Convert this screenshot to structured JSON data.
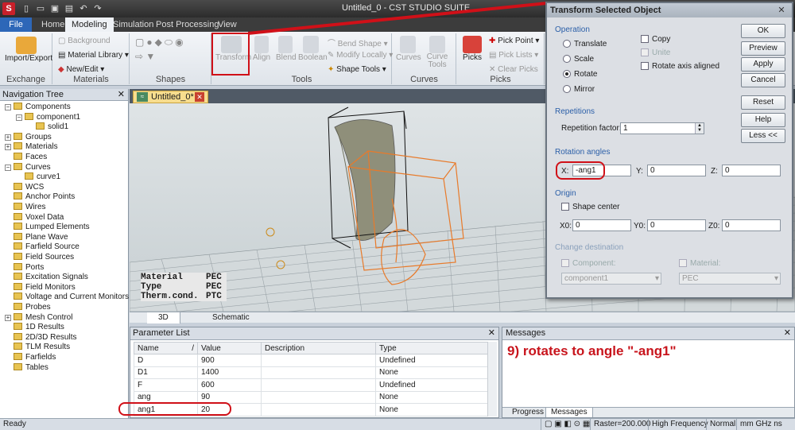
{
  "window": {
    "title": "Untitled_0 - CST STUDIO SUITE"
  },
  "menu_tabs": [
    "File",
    "Home",
    "Modeling",
    "Simulation",
    "Post Processing",
    "View"
  ],
  "ribbon": {
    "exchange": {
      "import_export": "Import/Export",
      "label": "Exchange"
    },
    "materials": {
      "background": "Background",
      "library": "Material Library",
      "new_edit": "New/Edit",
      "label": "Materials"
    },
    "shapes": {
      "label": "Shapes"
    },
    "tools": {
      "transform": "Transform",
      "align": "Align",
      "blend": "Blend",
      "boolean": "Boolean",
      "bend_shape": "Bend Shape",
      "modify_locally": "Modify Locally",
      "shape_tools": "Shape Tools",
      "label": "Tools"
    },
    "curves": {
      "curves": "Curves",
      "curve_tools": "Curve\nTools",
      "label": "Curves"
    },
    "picks": {
      "picks": "Picks",
      "pick_point": "Pick Point",
      "pick_lists": "Pick Lists",
      "clear_picks": "Clear Picks",
      "label": "Picks"
    }
  },
  "nav_tree": {
    "title": "Navigation Tree",
    "items": [
      {
        "label": "Components",
        "level": 0,
        "exp": "⊟"
      },
      {
        "label": "component1",
        "level": 1,
        "exp": "⊟"
      },
      {
        "label": "solid1",
        "level": 2,
        "exp": ""
      },
      {
        "label": "Groups",
        "level": 0,
        "exp": "⊞"
      },
      {
        "label": "Materials",
        "level": 0,
        "exp": "⊞"
      },
      {
        "label": "Faces",
        "level": 0,
        "exp": ""
      },
      {
        "label": "Curves",
        "level": 0,
        "exp": "⊟"
      },
      {
        "label": "curve1",
        "level": 1,
        "exp": ""
      },
      {
        "label": "WCS",
        "level": 0,
        "exp": ""
      },
      {
        "label": "Anchor Points",
        "level": 0,
        "exp": ""
      },
      {
        "label": "Wires",
        "level": 0,
        "exp": ""
      },
      {
        "label": "Voxel Data",
        "level": 0,
        "exp": ""
      },
      {
        "label": "Lumped Elements",
        "level": 0,
        "exp": ""
      },
      {
        "label": "Plane Wave",
        "level": 0,
        "exp": ""
      },
      {
        "label": "Farfield Source",
        "level": 0,
        "exp": ""
      },
      {
        "label": "Field Sources",
        "level": 0,
        "exp": ""
      },
      {
        "label": "Ports",
        "level": 0,
        "exp": ""
      },
      {
        "label": "Excitation Signals",
        "level": 0,
        "exp": ""
      },
      {
        "label": "Field Monitors",
        "level": 0,
        "exp": ""
      },
      {
        "label": "Voltage and Current Monitors",
        "level": 0,
        "exp": ""
      },
      {
        "label": "Probes",
        "level": 0,
        "exp": ""
      },
      {
        "label": "Mesh Control",
        "level": 0,
        "exp": "⊞"
      },
      {
        "label": "1D Results",
        "level": 0,
        "exp": ""
      },
      {
        "label": "2D/3D Results",
        "level": 0,
        "exp": ""
      },
      {
        "label": "TLM Results",
        "level": 0,
        "exp": ""
      },
      {
        "label": "Farfields",
        "level": 0,
        "exp": ""
      },
      {
        "label": "Tables",
        "level": 0,
        "exp": ""
      }
    ]
  },
  "doc_tab": {
    "label": "Untitled_0*"
  },
  "viewport": {
    "properties": [
      {
        "key": "Material",
        "value": "PEC"
      },
      {
        "key": "Type",
        "value": "PEC"
      },
      {
        "key": "Therm.cond.",
        "value": "PTC"
      }
    ],
    "tabs": [
      "3D",
      "Schematic"
    ]
  },
  "param_list": {
    "title": "Parameter List",
    "columns": [
      "Name",
      "/",
      "Value",
      "Description",
      "Type"
    ],
    "rows": [
      {
        "name": "D",
        "value": "900",
        "description": "",
        "type": "Undefined"
      },
      {
        "name": "D1",
        "value": "1400",
        "description": "",
        "type": "None"
      },
      {
        "name": "F",
        "value": "600",
        "description": "",
        "type": "Undefined"
      },
      {
        "name": "ang",
        "value": "90",
        "description": "",
        "type": "None"
      },
      {
        "name": "ang1",
        "value": "20",
        "description": "",
        "type": "None"
      }
    ]
  },
  "messages": {
    "title": "Messages",
    "annotation": "9) rotates to angle \"-ang1\"",
    "tabs": [
      "Progress",
      "Messages"
    ]
  },
  "status": {
    "ready": "Ready",
    "raster": "Raster=200.000",
    "freq": "High Frequency",
    "mode": "Normal",
    "units": "mm  GHz  ns  °C"
  },
  "dialog": {
    "title": "Transform Selected Object",
    "operation_label": "Operation",
    "ops": [
      "Translate",
      "Scale",
      "Rotate",
      "Mirror"
    ],
    "selected_op": "Rotate",
    "copy": "Copy",
    "unite": "Unite",
    "rotate_axis": "Rotate axis aligned",
    "buttons": [
      "OK",
      "Preview",
      "Apply",
      "Cancel",
      "Reset",
      "Help",
      "Less <<"
    ],
    "repetitions_label": "Repetitions",
    "repetition_factor_label": "Repetition factor:",
    "repetition_factor": "1",
    "rotation_angles_label": "Rotation angles",
    "rx_label": "X:",
    "rx": "-ang1",
    "ry_label": "Y:",
    "ry": "0",
    "rz_label": "Z:",
    "rz": "0",
    "origin_label": "Origin",
    "shape_center": "Shape center",
    "x0_label": "X0:",
    "x0": "0",
    "y0_label": "Y0:",
    "y0": "0",
    "z0_label": "Z0:",
    "z0": "0",
    "change_dest_label": "Change destination",
    "component_label": "Component:",
    "component_value": "component1",
    "material_label": "Material:",
    "material_value": "PEC"
  },
  "colors": {
    "annotation_red": "#d01018",
    "file_tab": "#2d67b8",
    "selection_orange": "#e87a2a"
  }
}
